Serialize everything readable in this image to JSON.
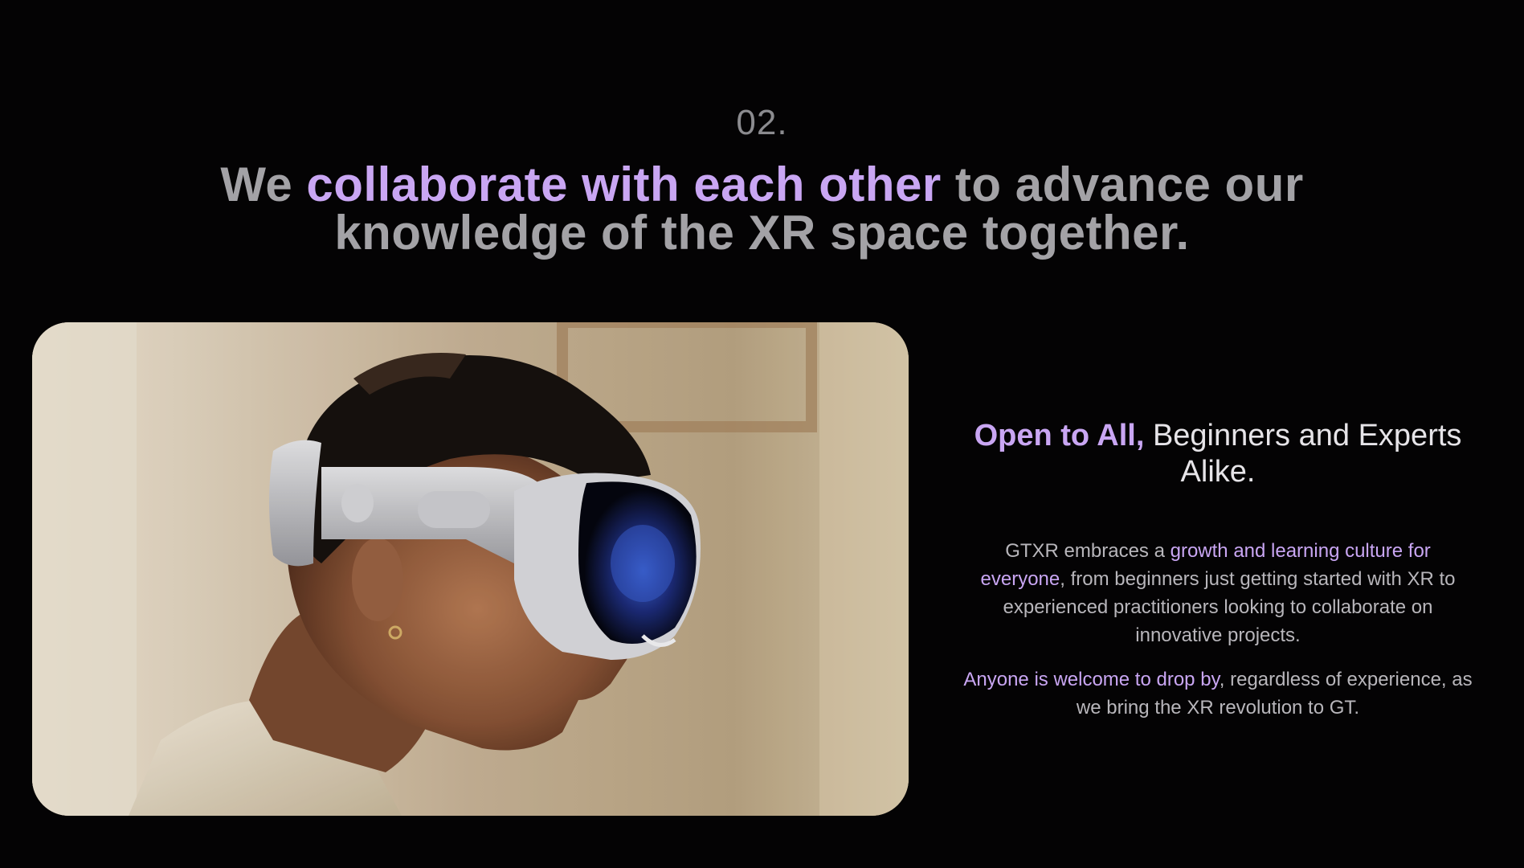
{
  "section": {
    "number": "02."
  },
  "headline": {
    "part1": "We ",
    "accent": "collaborate with each other",
    "part2": " to advance our knowledge of the XR space together."
  },
  "photo": {
    "subject": "person-wearing-xr-headset"
  },
  "side": {
    "title_accent": "Open to All,",
    "title_rest": " Beginners and Experts Alike.",
    "para1_start": "GTXR embraces a ",
    "para1_accent": "growth and learning culture for everyone",
    "para1_end": ", from beginners just getting started with XR to experienced practitioners looking to collaborate on innovative projects.",
    "para2_accent": "Anyone is welcome to drop by",
    "para2_end": ", regardless of experience, as we bring the XR revolution to GT."
  },
  "colors": {
    "background": "#040304",
    "accent": "#c9a6f3",
    "headline_gray": "#a3a2a6",
    "body_gray": "#b8b6bb"
  }
}
